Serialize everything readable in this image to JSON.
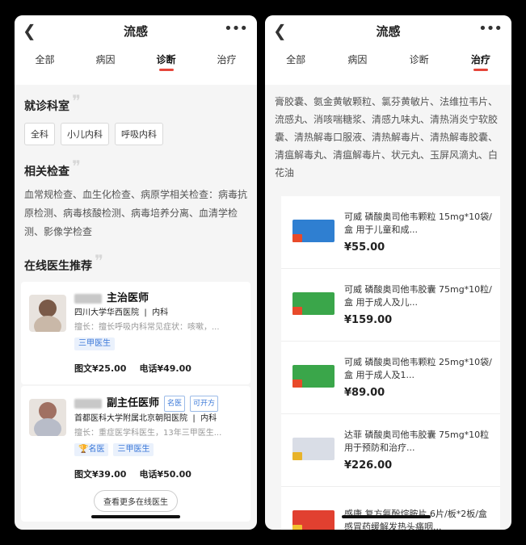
{
  "left": {
    "title": "流感",
    "tabs": [
      "全部",
      "病因",
      "诊断",
      "治疗"
    ],
    "dept_title": "就诊科室",
    "depts": [
      "全科",
      "小儿内科",
      "呼吸内科"
    ],
    "exam_title": "相关检查",
    "exam_text": "血常规检查、血生化检查、病原学相关检查：病毒抗原检测、病毒核酸检测、病毒培养分离、血清学检测、影像学检查",
    "doctor_title": "在线医生推荐",
    "doctors": [
      {
        "title": "主治医师",
        "hospital": "四川大学华西医院",
        "dept": "内科",
        "good_at": "擅长：擅长呼吸内科常见症状：咳嗽，...",
        "badge": "三甲医生",
        "img_price": "图文¥25.00",
        "phone_price": "电话¥49.00"
      },
      {
        "title": "副主任医师",
        "tags": [
          "名医",
          "可开方"
        ],
        "hospital": "首都医科大学附属北京朝阳医院",
        "dept": "内科",
        "good_at": "擅长：重症医学科医生，13年三甲医生...",
        "badges": [
          "名医",
          "三甲医生"
        ],
        "img_price": "图文¥39.00",
        "phone_price": "电话¥50.00"
      }
    ],
    "more_doctors": "查看更多在线医生"
  },
  "right": {
    "title": "流感",
    "tabs": [
      "全部",
      "病因",
      "诊断",
      "治疗"
    ],
    "drug_text": "膏胶囊、氨金黄敏颗粒、氯芬黄敏片、法维拉韦片、流感丸、消咳喘糖浆、清感九味丸、清热消炎宁软胶囊、清热解毒口服液、清热解毒片、清热解毒胶囊、清瘟解毒丸、清瘟解毒片、状元丸、玉屏风滴丸、白花油",
    "products": [
      {
        "name": "可威 磷酸奥司他韦颗粒 15mg*10袋/盒 用于儿童和成...",
        "price": "¥55.00",
        "box_color": "#2f7fd1",
        "stripe_color": "#e84a2a"
      },
      {
        "name": "可威 磷酸奥司他韦胶囊 75mg*10粒/盒 用于成人及儿...",
        "price": "¥159.00",
        "box_color": "#3aa64a",
        "stripe_color": "#e84a2a"
      },
      {
        "name": "可威 磷酸奥司他韦颗粒 25mg*10袋/盒 用于成人及1...",
        "price": "¥89.00",
        "box_color": "#3aa64a",
        "stripe_color": "#e84a2a"
      },
      {
        "name": "达菲 磷酸奥司他韦胶囊 75mg*10粒 用于预防和治疗...",
        "price": "¥226.00",
        "box_color": "#d9dde6",
        "stripe_color": "#e8b32a"
      },
      {
        "name": "感康 复方氨酚烷胺片 6片/板*2板/盒 感冒药缓解发热头痛咽...",
        "price": "",
        "box_color": "#e14030",
        "stripe_color": "#f2c230"
      }
    ]
  }
}
